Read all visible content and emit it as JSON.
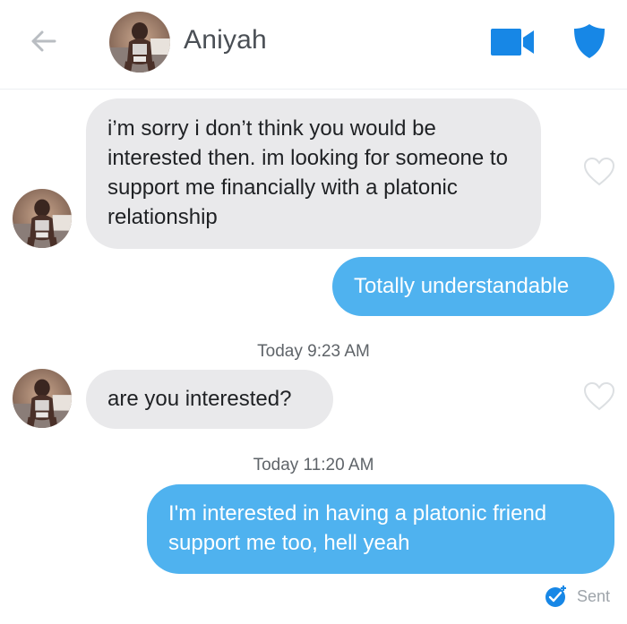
{
  "header": {
    "contact_name": "Aniyah"
  },
  "messages": [
    {
      "direction": "received",
      "text": "i’m sorry i don’t think you would be interested then. im looking for someone to support me financially with a platonic relationship"
    },
    {
      "direction": "sent",
      "text": "Totally understandable"
    },
    {
      "direction": "received",
      "text": "are you interested?"
    },
    {
      "direction": "sent",
      "text": "I'm interested in having a platonic friend support me too, hell yeah"
    }
  ],
  "timestamps": [
    {
      "day": "Today",
      "time": "9:23 AM"
    },
    {
      "day": "Today",
      "time": "11:20 AM"
    }
  ],
  "status": {
    "label": "Sent"
  },
  "icons": {
    "back": "arrow-left-icon",
    "video": "video-camera-icon",
    "safety": "shield-icon",
    "like": "heart-outline-icon",
    "sent": "check-badge-icon"
  },
  "colors": {
    "accent": "#4fb2ef",
    "sent_bubble": "#4fb2ef",
    "received_bubble": "#e9e9eb",
    "header_icon": "#1787e6"
  }
}
